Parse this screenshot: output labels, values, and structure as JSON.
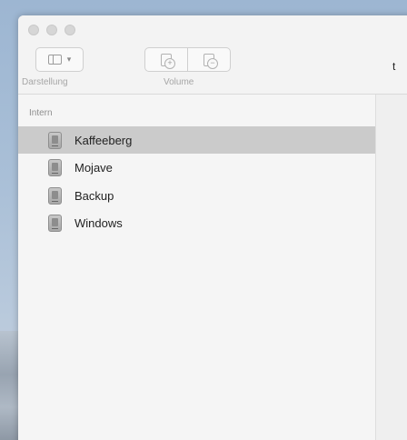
{
  "toolbar": {
    "view_label": "Darstellung",
    "volume_label": "Volume",
    "view_icon": "sidebar-icon",
    "view_chevron": "▾",
    "add_icon": "add-volume-icon",
    "remove_icon": "remove-volume-icon"
  },
  "sidebar": {
    "section": "Intern",
    "items": [
      {
        "label": "Kaffeeberg",
        "selected": true
      },
      {
        "label": "Mojave"
      },
      {
        "label": "Backup"
      },
      {
        "label": "Windows"
      }
    ]
  },
  "main": {
    "partial_text": "t"
  },
  "colors": {
    "selection": "#cbcbcb",
    "window_bg": "#f3f3f3",
    "desktop": "#a9bfd7"
  }
}
